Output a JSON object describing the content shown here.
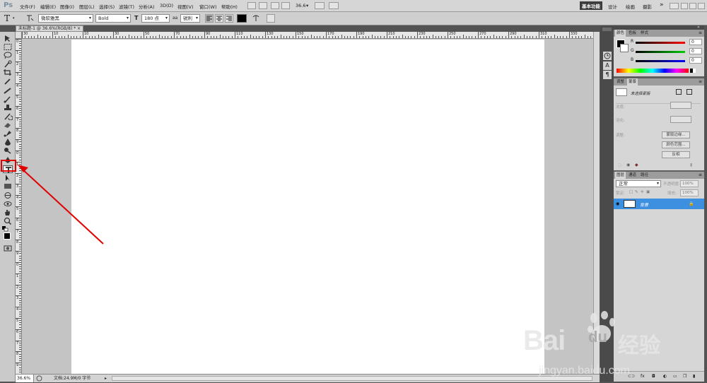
{
  "menubar": {
    "logo": "Ps",
    "items": [
      "文件(F)",
      "编辑(E)",
      "图像(I)",
      "图层(L)",
      "选择(S)",
      "滤镜(T)",
      "分析(A)",
      "3D(D)",
      "视图(V)",
      "窗口(W)",
      "帮助(H)"
    ],
    "zoom": "36.6",
    "workspaces": [
      "基本功能",
      "设计",
      "绘画",
      "摄影"
    ],
    "more": "»"
  },
  "options": {
    "tool_icon": "T",
    "font_family": "微软雅黑",
    "font_style": "Bold",
    "font_size": "180 点",
    "aa_label": "aa",
    "antialias": "锐利"
  },
  "document": {
    "tab_title": "未标题-1 @ 36.6%(RGB/8) *",
    "close": "×"
  },
  "rulers": {
    "h": [
      "30",
      "10",
      "10",
      "30",
      "50",
      "70",
      "90",
      "110",
      "130",
      "150",
      "170",
      "190",
      "210",
      "230",
      "250",
      "270",
      "290",
      "310",
      "330"
    ],
    "v": [
      "0",
      "1",
      "2",
      "3",
      "4",
      "5",
      "6",
      "7",
      "8",
      "9",
      "0",
      "1",
      "2",
      "3",
      "4",
      "5",
      "6",
      "7",
      "8",
      "9",
      "0",
      "1",
      "2",
      "3",
      "4",
      "5",
      "6",
      "7",
      "8",
      "9"
    ]
  },
  "status": {
    "zoom": "36.6%",
    "doc": "文档:24.9M/0 字节"
  },
  "color_panel": {
    "tabs": [
      "颜色",
      "色板",
      "样式"
    ],
    "channels": [
      {
        "label": "R",
        "value": "0",
        "color": "#d01c1c"
      },
      {
        "label": "G",
        "value": "0",
        "color": "#1aa01a"
      },
      {
        "label": "B",
        "value": "0",
        "color": "#1c3cd0"
      }
    ]
  },
  "adjust_panel": {
    "tabs": [
      "调整",
      "蒙版"
    ],
    "no_selection": "未选择蒙版",
    "density": "浓度:",
    "feather": "羽化:",
    "refine": "调整:",
    "buttons": [
      "蒙版边缘...",
      "颜色范围...",
      "反相"
    ]
  },
  "layers_panel": {
    "tabs": [
      "图层",
      "通道",
      "路径"
    ],
    "blend": "正常",
    "opacity_label": "不透明度:",
    "opacity": "100%",
    "lock_label": "锁定:",
    "fill_label": "填充:",
    "fill": "100%",
    "layer_name": "背景",
    "highlight": "#3d8fe0"
  },
  "watermark": {
    "brand": "Bai",
    "brand2": "du",
    "cn": "经验",
    "url": "jingyan.baidu.com"
  },
  "colors": {
    "accent_red": "#e00000",
    "canvas": "#ffffff"
  }
}
